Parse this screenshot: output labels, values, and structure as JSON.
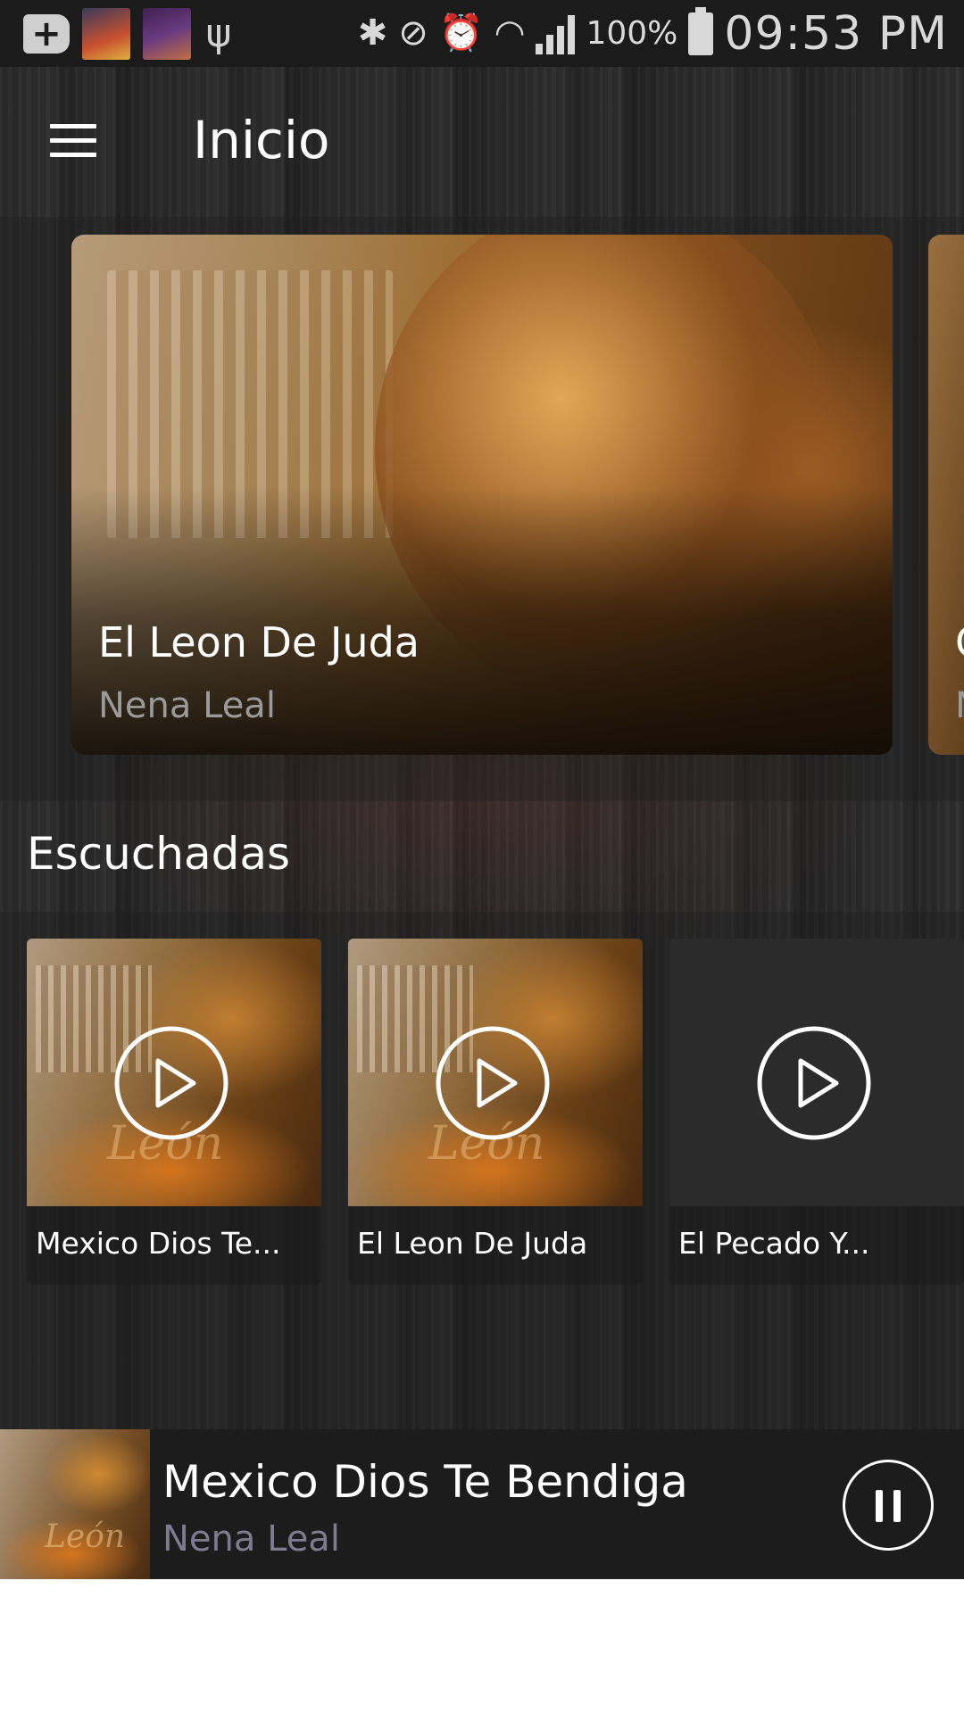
{
  "status_bar": {
    "battery": "100%",
    "time": "09:53 PM",
    "icons": [
      "add-icon",
      "notification-thumbnail",
      "notification-thumbnail",
      "usb-icon",
      "bluetooth-icon",
      "vibrate-icon",
      "alarm-icon",
      "wifi-icon",
      "signal-icon",
      "battery-icon"
    ]
  },
  "toolbar": {
    "title": "Inicio",
    "menu_icon": "hamburger-menu-icon"
  },
  "featured": [
    {
      "title": "El Leon De Juda",
      "artist": "Nena Leal"
    },
    {
      "title": "C",
      "artist": "N"
    }
  ],
  "section": {
    "title": "Escuchadas"
  },
  "songs": [
    {
      "title": "Mexico  Dios Te...",
      "art_text": "León"
    },
    {
      "title": "El Leon De Juda",
      "art_text": "León"
    },
    {
      "title": "El Pecado Y..."
    }
  ],
  "now_playing": {
    "title": "Mexico  Dios Te Bendiga",
    "artist": "Nena Leal",
    "art_text": "León",
    "control_icon": "pause-icon"
  },
  "colors": {
    "background": "#2a2a2a",
    "status_bar": "#1b1b1b",
    "now_playing_bar": "#1c1c1c",
    "artist_text": "#9a9a9a",
    "now_playing_artist": "#7e7a90"
  }
}
